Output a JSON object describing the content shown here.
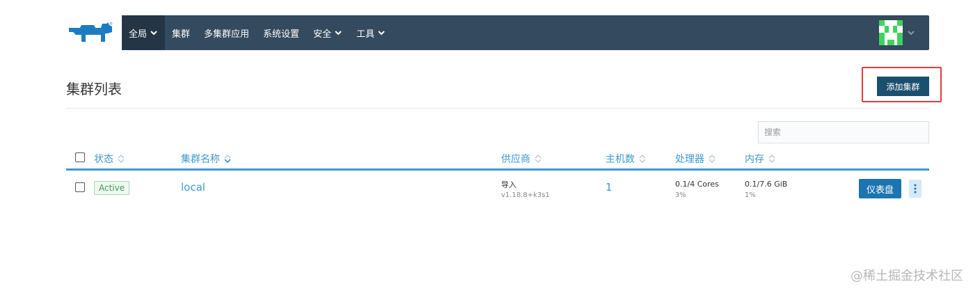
{
  "nav": {
    "items": [
      {
        "label": "全局",
        "has_dropdown": true,
        "active": true
      },
      {
        "label": "集群",
        "has_dropdown": false
      },
      {
        "label": "多集群应用",
        "has_dropdown": false
      },
      {
        "label": "系统设置",
        "has_dropdown": false
      },
      {
        "label": "安全",
        "has_dropdown": true
      },
      {
        "label": "工具",
        "has_dropdown": true
      }
    ],
    "logo_icon": "rancher-cow-logo",
    "avatar_icon": "identicon-avatar",
    "colors": {
      "bar": "#344a5e",
      "active": "#243646"
    }
  },
  "header": {
    "title": "集群列表",
    "add_button_label": "添加集群"
  },
  "search": {
    "placeholder": "搜索",
    "value": ""
  },
  "table": {
    "columns": [
      {
        "label": "状态"
      },
      {
        "label": "集群名称"
      },
      {
        "label": "供应商"
      },
      {
        "label": "主机数"
      },
      {
        "label": "处理器"
      },
      {
        "label": "内存"
      }
    ],
    "rows": [
      {
        "status": "Active",
        "name": "local",
        "provider": "导入",
        "provider_version": "v1.18.8+k3s1",
        "nodes": "1",
        "cpu": "0.1/4 Cores",
        "cpu_percent": "3%",
        "memory": "0.1/7.6 GiB",
        "memory_percent": "1%",
        "dashboard_label": "仪表盘"
      }
    ]
  },
  "watermark": "@稀土掘金技术社区"
}
